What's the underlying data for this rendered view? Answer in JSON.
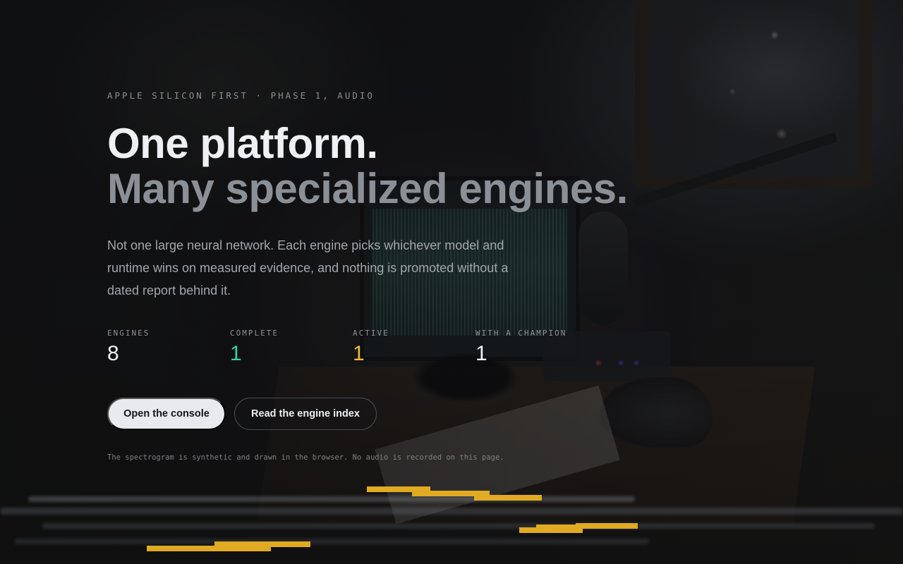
{
  "hero": {
    "eyebrow": "APPLE SILICON FIRST · PHASE 1, AUDIO",
    "headline_line1": "One platform.",
    "headline_line2": "Many specialized engines.",
    "lede": "Not one large neural network. Each engine picks whichever model and runtime wins on measured evidence, and nothing is promoted without a dated report behind it."
  },
  "stats": [
    {
      "label": "ENGINES",
      "value": "8",
      "color": "#f1f2f4"
    },
    {
      "label": "COMPLETE",
      "value": "1",
      "color": "#35d39a"
    },
    {
      "label": "ACTIVE",
      "value": "1",
      "color": "#f2b93b"
    },
    {
      "label": "WITH A CHAMPION",
      "value": "1",
      "color": "#f1f2f4"
    }
  ],
  "actions": {
    "primary_label": "Open the console",
    "secondary_label": "Read the engine index"
  },
  "footnote": "The spectrogram is synthetic and drawn in the browser. No audio is recorded on this page.",
  "colors": {
    "accent_complete": "#35d39a",
    "accent_active": "#f2b93b",
    "spectrogram_streak": "#e0aa22",
    "background": "#0e0f11"
  }
}
